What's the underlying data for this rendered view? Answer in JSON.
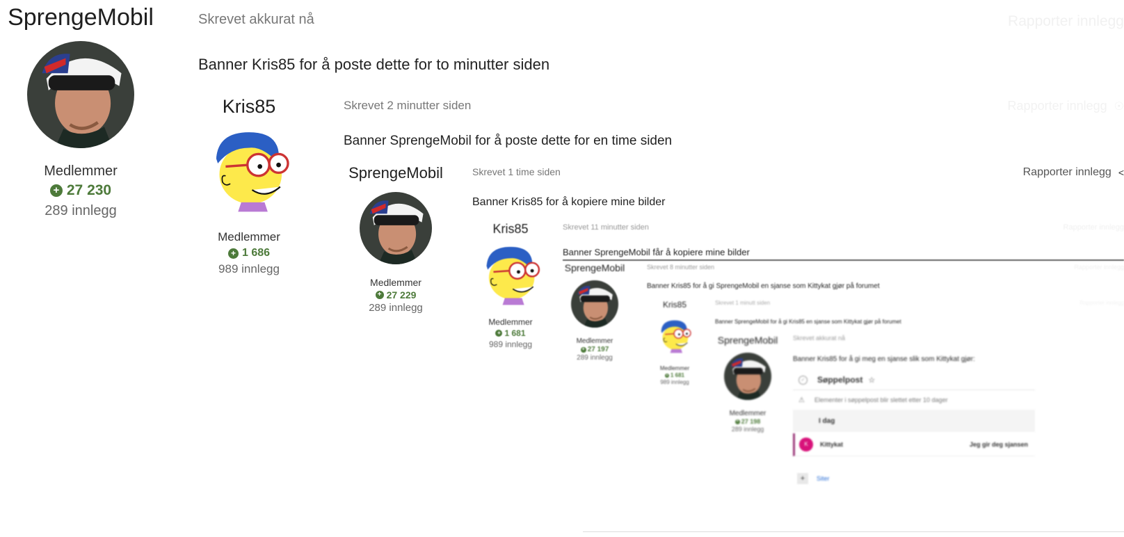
{
  "posts": {
    "p1": {
      "username": "SprengeMobil",
      "rank": "Medlemmer",
      "reputation": "27 230",
      "posts": "289 innlegg",
      "meta": "Skrevet akkurat nå",
      "report": "Rapporter innlegg",
      "body": "Banner Kris85 for å poste dette for to minutter siden"
    },
    "p2": {
      "username": "Kris85",
      "rank": "Medlemmer",
      "reputation": "1 686",
      "posts": "989 innlegg",
      "meta": "Skrevet 2 minutter siden",
      "report": "Rapporter innlegg",
      "body": "Banner SprengeMobil for å poste dette for en time siden"
    },
    "p3": {
      "username": "SprengeMobil",
      "rank": "Medlemmer",
      "reputation": "27 229",
      "posts": "289 innlegg",
      "meta": "Skrevet 1 time siden",
      "report": "Rapporter innlegg",
      "body": "Banner Kris85 for å kopiere mine bilder"
    },
    "p4": {
      "username": "Kris85",
      "rank": "Medlemmer",
      "reputation": "1 681",
      "posts": "989 innlegg",
      "meta": "Skrevet 11 minutter siden",
      "report": "Rapporter innlegg",
      "body": "Banner SprengeMobil får å kopiere mine bilder"
    },
    "p5": {
      "username": "SprengeMobil",
      "rank": "Medlemmer",
      "reputation": "27 197",
      "posts": "289 innlegg",
      "meta": "Skrevet 8 minutter siden",
      "report": "Rapporter innlegg",
      "body": "Banner Kris85 for å gi SprengeMobil en sjanse som Kittykat gjør på forumet"
    },
    "p6": {
      "username": "Kris85",
      "rank": "Medlemmer",
      "reputation": "1 681",
      "posts": "989 innlegg",
      "meta": "Skrevet 1 minutt siden",
      "report": "Rapporter innlegg",
      "body": "Banner SprengeMobil for å gi Kris85 en sjanse som Kittykat gjør på forumet"
    },
    "p7": {
      "username": "SprengeMobil",
      "rank": "Medlemmer",
      "reputation": "27 198",
      "posts": "289 innlegg",
      "meta": "Skrevet akkurat nå",
      "body": "Banner Kris85 for å gi meg en sjanse slik som Kittykat gjør:"
    }
  },
  "mail": {
    "folder_title": "Søppelpost",
    "notice": "Elementer i søppelpost blir slettet etter 10 dager",
    "group": "I dag",
    "item": {
      "avatar_letter": "K",
      "sender": "Kittykat",
      "preview": "Jeg gir deg sjansen"
    },
    "footer_link": "Siter"
  },
  "colors": {
    "reputation_green": "#4d7a3a",
    "mail_accent": "#9d3b7c",
    "avatar_pink": "#d8127a",
    "link_blue": "#2a6fd6"
  },
  "icons": {
    "report": "share-icon",
    "reputation": "plus-circle-icon",
    "mail_check": "check-circle-icon",
    "mail_star": "star-icon",
    "mail_warning": "warning-icon",
    "mail_add": "plus-icon"
  }
}
